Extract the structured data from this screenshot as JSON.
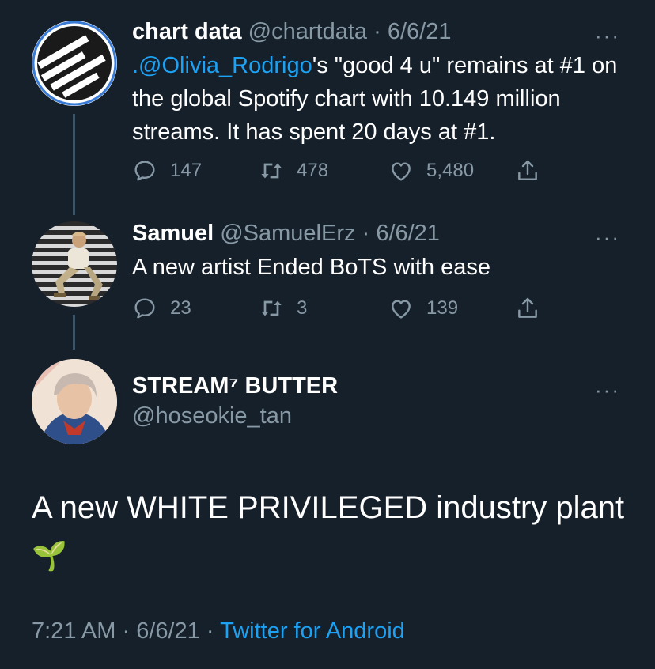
{
  "tweets": [
    {
      "name": "chart data",
      "handle": "@chartdata",
      "sep": "·",
      "date": "6/6/21",
      "more": "···",
      "mention": ".@Olivia_Rodrigo",
      "text": "'s \"good 4 u\" remains at #1 on the global Spotify chart with 10.149 million streams. It has spent 20 days at #1.",
      "replies": "147",
      "retweets": "478",
      "likes": "5,480"
    },
    {
      "name": "Samuel",
      "handle": "@SamuelErz",
      "sep": "·",
      "date": "6/6/21",
      "more": "···",
      "text": "A new artist Ended BoTS with ease",
      "replies": "23",
      "retweets": "3",
      "likes": "139"
    }
  ],
  "main": {
    "name": "STREAM⁷ BUTTER",
    "handle": "@hoseokie_tan",
    "more": "···",
    "text": "A new WHITE PRIVILEGED industry plant",
    "emoji": "🌱",
    "time": "7:21 AM",
    "sep1": " · ",
    "date": "6/6/21",
    "sep2": " · ",
    "source": "Twitter for Android"
  },
  "icons": [
    "reply-icon",
    "retweet-icon",
    "like-icon",
    "share-icon",
    "sprout-emoji"
  ],
  "colors": {
    "background": "#15202b",
    "muted": "#8899a6",
    "link": "#1da1f2",
    "text": "#ffffff"
  }
}
